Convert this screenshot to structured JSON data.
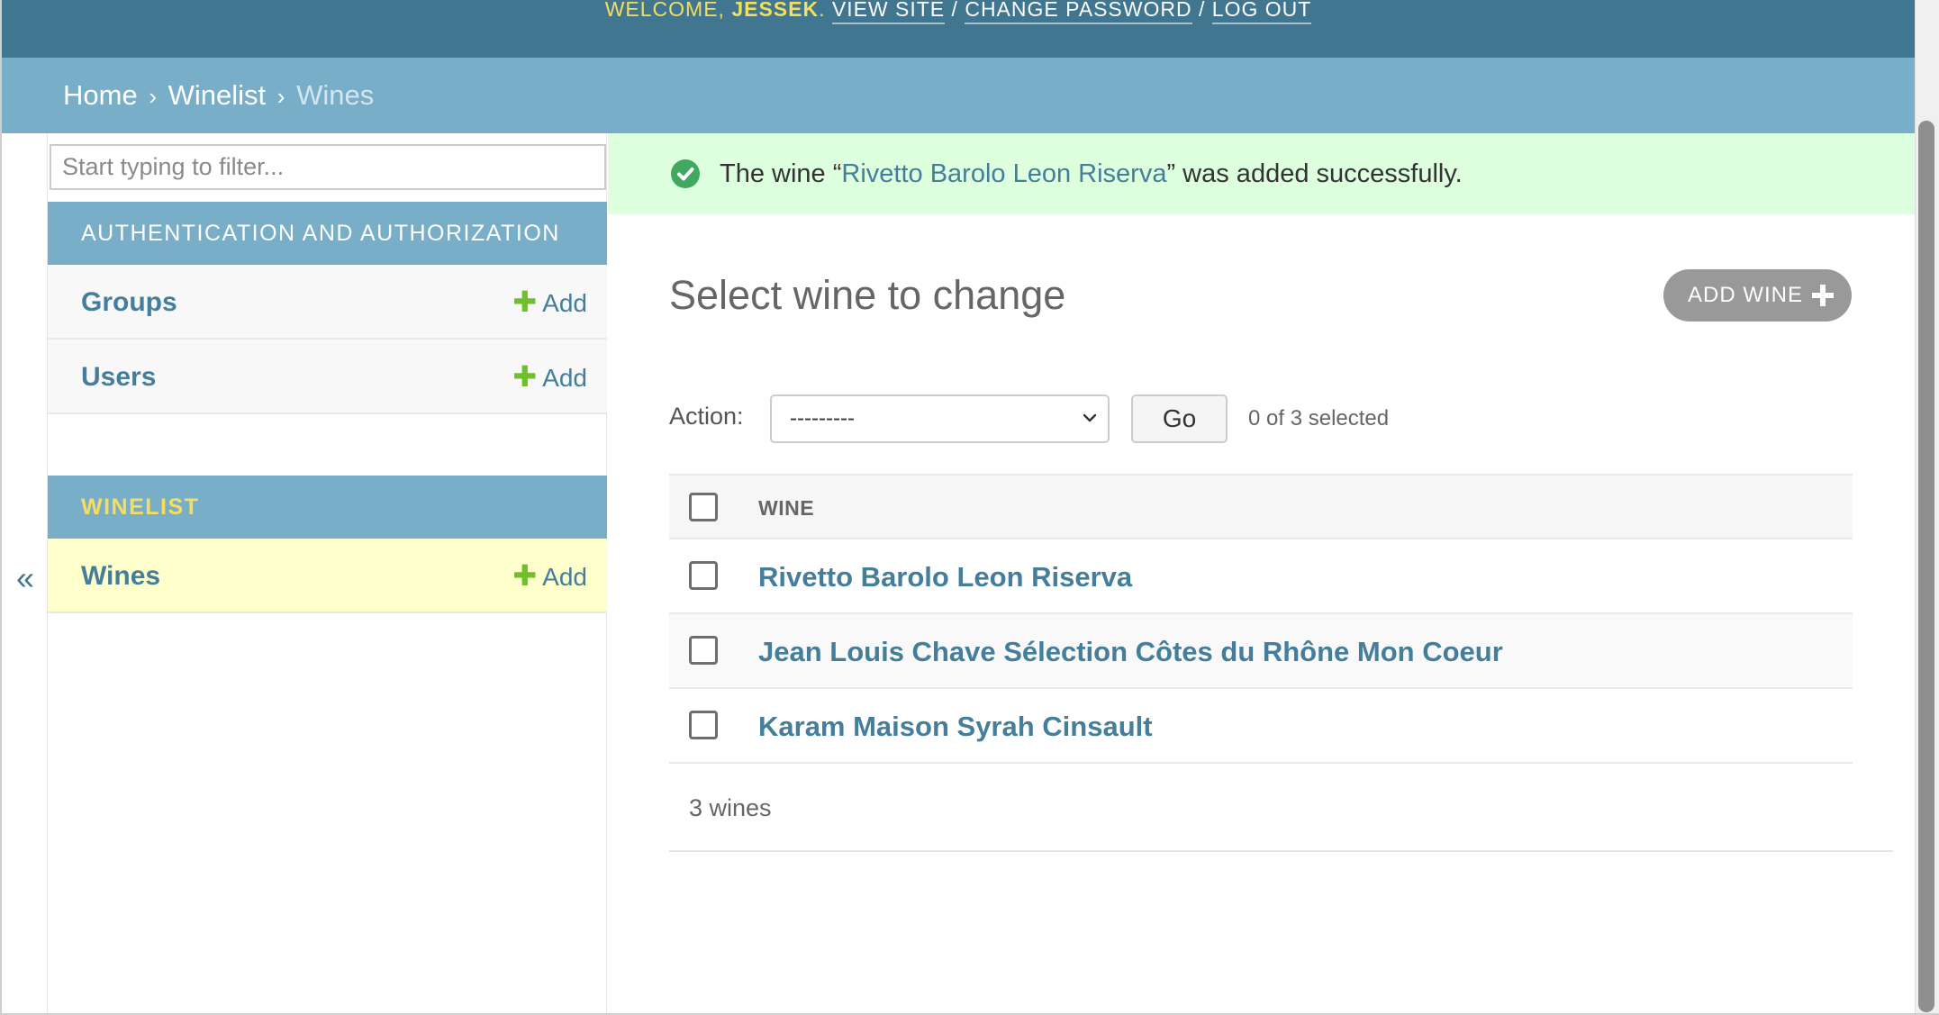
{
  "header": {
    "welcome_label": "WELCOME,",
    "username": "JESSEK",
    "period": ".",
    "view_site": "VIEW SITE",
    "change_password": "CHANGE PASSWORD",
    "log_out": "LOG OUT",
    "separator": "/"
  },
  "breadcrumbs": {
    "home": "Home",
    "app": "Winelist",
    "current": "Wines",
    "separator": "›"
  },
  "sidebar": {
    "toggle_label": "«",
    "filter_placeholder": "Start typing to filter...",
    "modules": [
      {
        "caption": "AUTHENTICATION AND AUTHORIZATION",
        "models": [
          {
            "name": "Groups",
            "add": "Add"
          },
          {
            "name": "Users",
            "add": "Add"
          }
        ]
      },
      {
        "caption": "WINELIST",
        "models": [
          {
            "name": "Wines",
            "add": "Add"
          }
        ]
      }
    ]
  },
  "message": {
    "prefix": "The wine “",
    "link": "Rivetto Barolo Leon Riserva",
    "suffix": "” was added successfully."
  },
  "main": {
    "title": "Select wine to change",
    "add_button": "ADD WINE",
    "action_label": "Action:",
    "action_selected": "---------",
    "go_button": "Go",
    "counter": "0 of 3 selected",
    "column_header": "WINE",
    "rows": [
      "Rivetto Barolo Leon Riserva",
      "Jean Louis Chave Sélection Côtes du Rhône Mon Coeur",
      "Karam Maison Syrah Cinsault"
    ],
    "paginator": "3 wines"
  },
  "colors": {
    "header_bg": "#417690",
    "breadcrumb_bg": "#79aec8",
    "success_bg": "#ddffdd",
    "link": "#447e9b",
    "current_model_bg": "#ffffcc",
    "add_plus": "#70bf2b"
  }
}
